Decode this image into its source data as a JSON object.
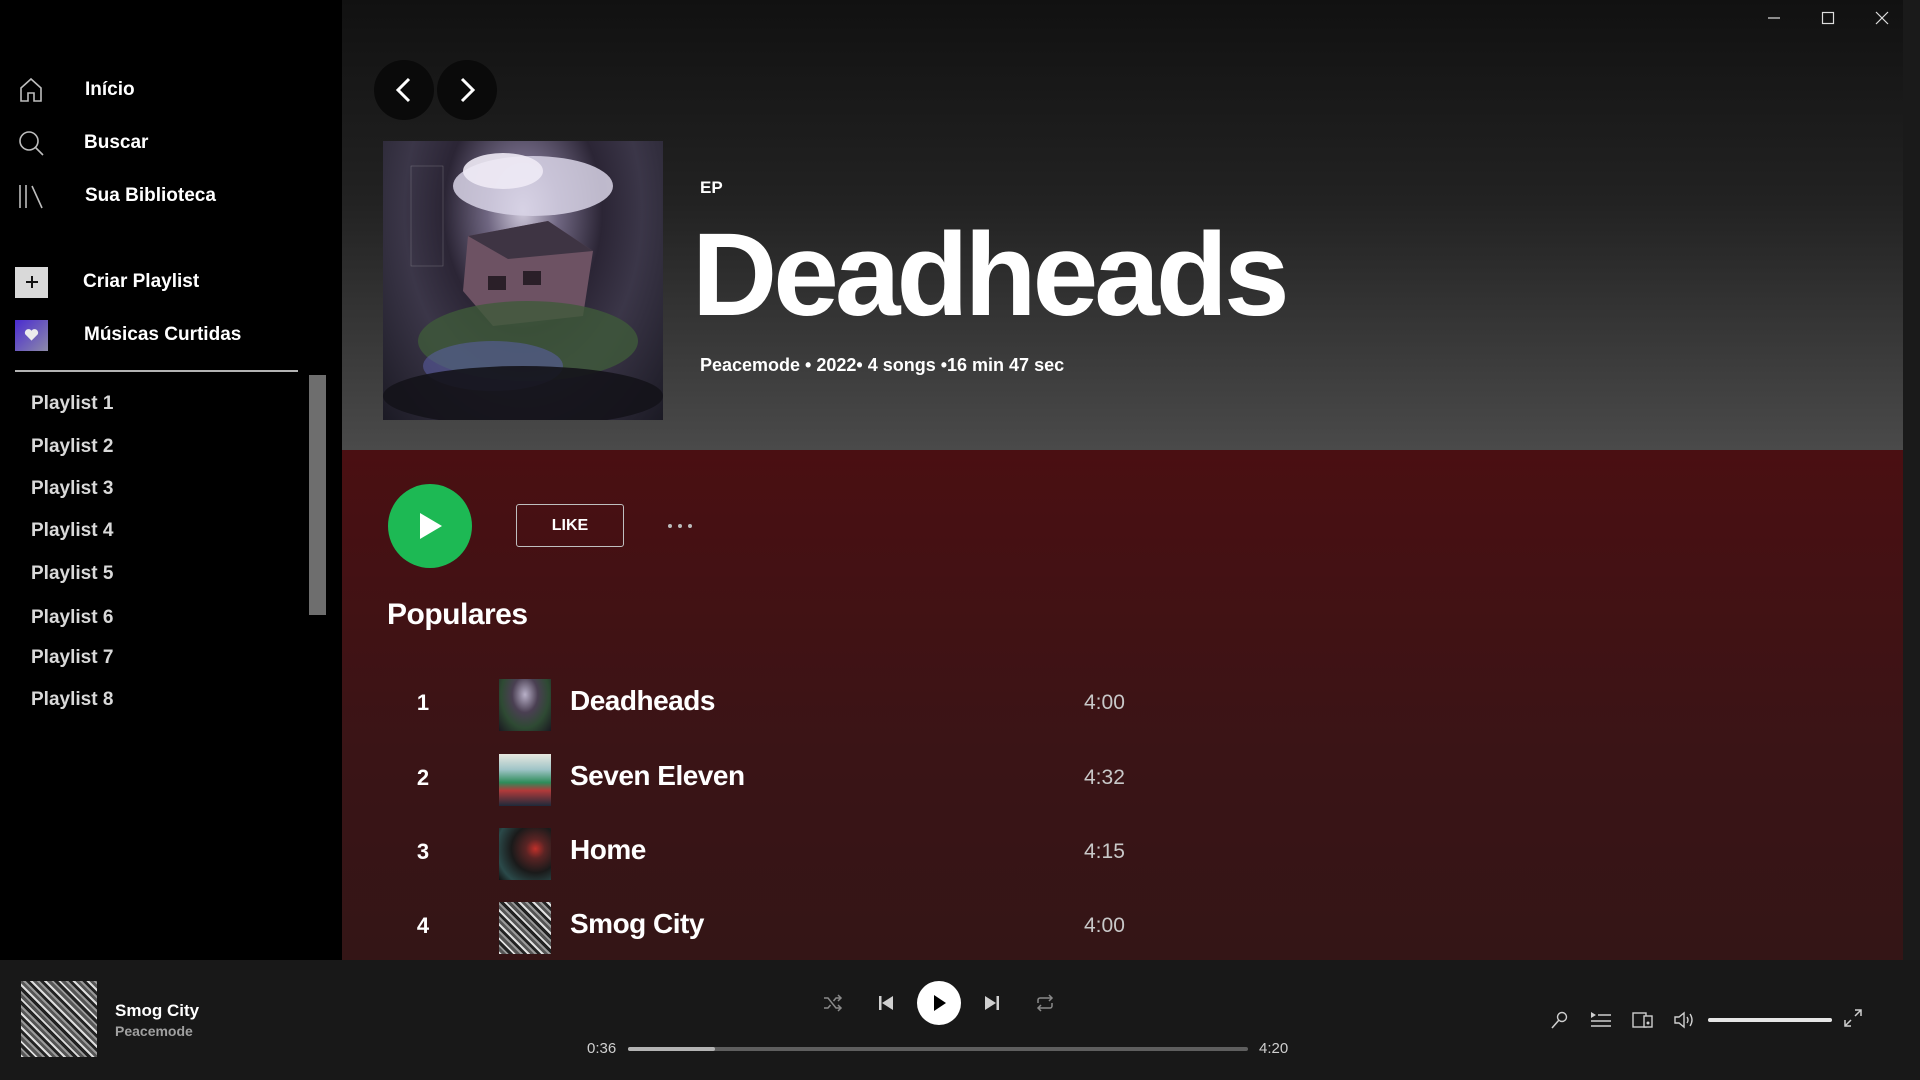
{
  "sidebar": {
    "nav": [
      {
        "label": "Início",
        "icon": "home-icon"
      },
      {
        "label": "Buscar",
        "icon": "search-icon"
      },
      {
        "label": "Sua Biblioteca",
        "icon": "library-icon"
      }
    ],
    "actions": [
      {
        "label": "Criar Playlist",
        "icon": "plus-icon"
      },
      {
        "label": "Músicas Curtidas",
        "icon": "heart-icon"
      }
    ],
    "playlists": [
      "Playlist 1",
      "Playlist 2",
      "Playlist 3",
      "Playlist 4",
      "Playlist 5",
      "Playlist 6",
      "Playlist 7",
      "Playlist 8"
    ]
  },
  "album": {
    "type": "EP",
    "title": "Deadheads",
    "meta": "Peacemode • 2022• 4 songs •16 min 47 sec",
    "like_label": "LIKE",
    "section_title": "Populares",
    "tracks": [
      {
        "num": "1",
        "name": "Deadheads",
        "duration": "4:00"
      },
      {
        "num": "2",
        "name": "Seven Eleven",
        "duration": "4:32"
      },
      {
        "num": "3",
        "name": "Home",
        "duration": "4:15"
      },
      {
        "num": "4",
        "name": "Smog City",
        "duration": "4:00"
      }
    ]
  },
  "player": {
    "title": "Smog City",
    "artist": "Peacemode",
    "elapsed": "0:36",
    "total": "4:20",
    "progress_fraction": 0.14,
    "volume_fraction": 1.0
  },
  "colors": {
    "accent": "#1db954",
    "body_background": "#3a1416"
  }
}
